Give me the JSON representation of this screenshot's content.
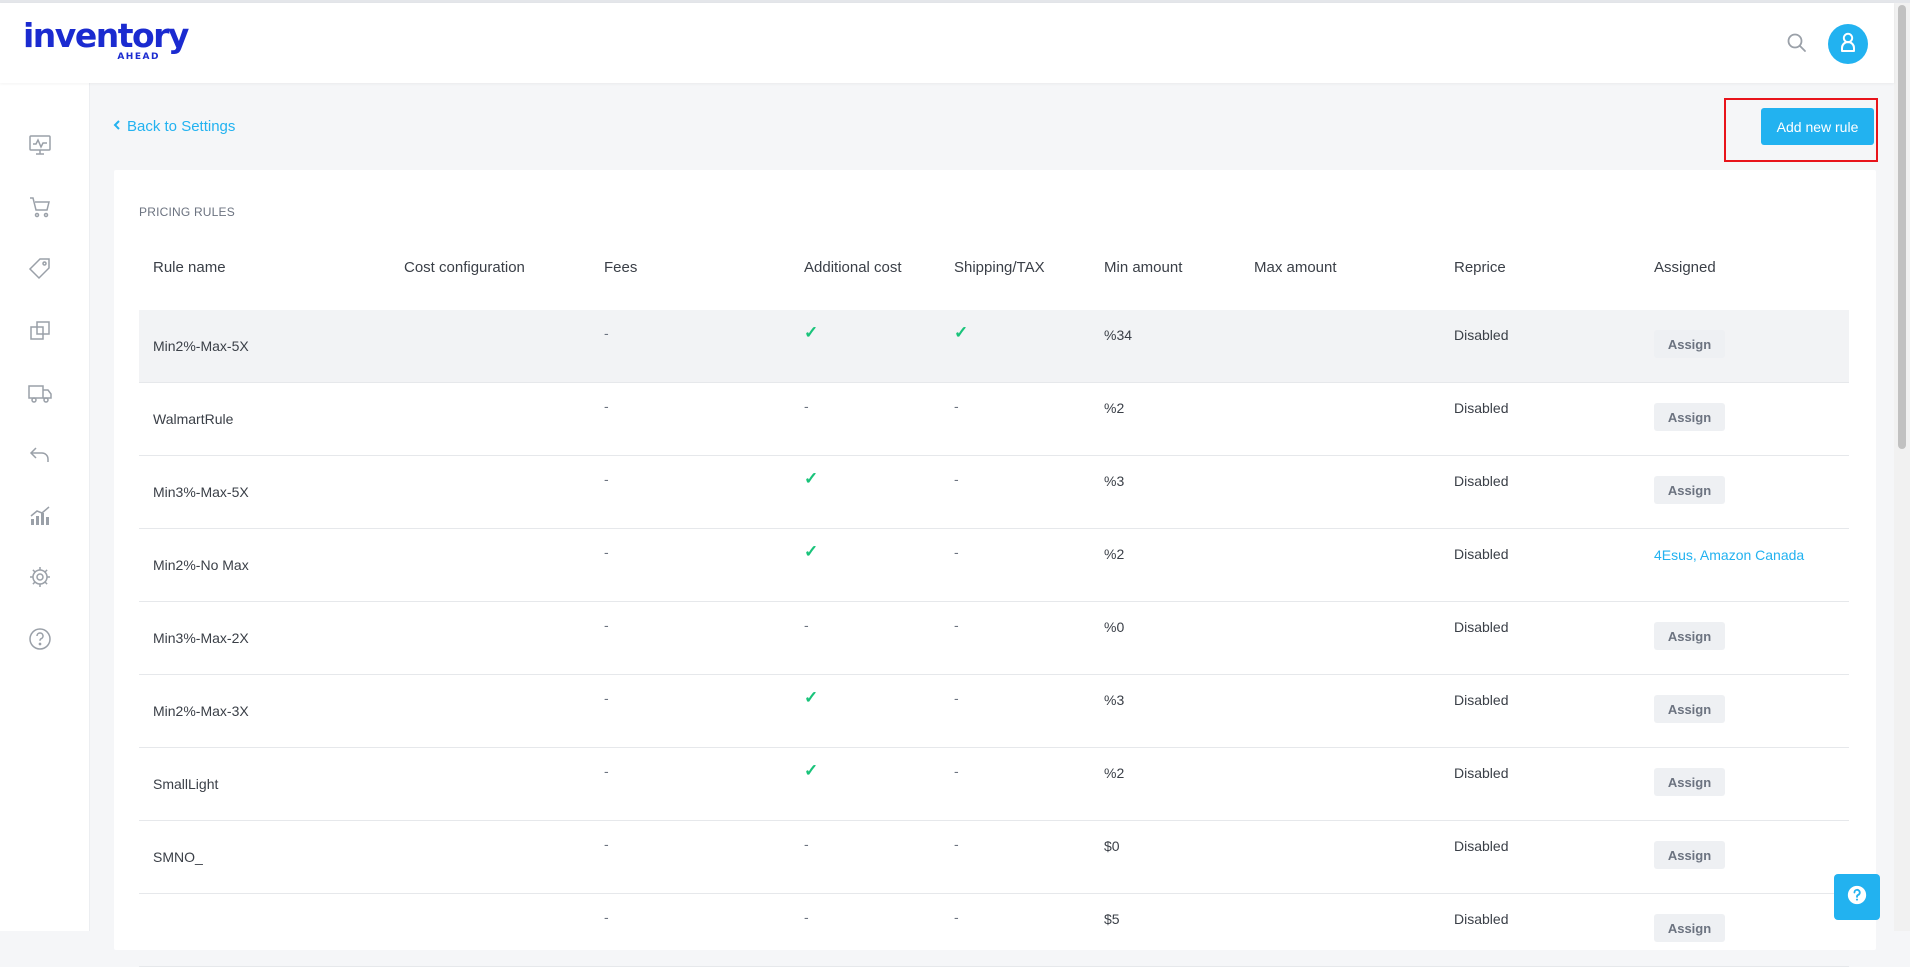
{
  "brand": {
    "logo_main": "inventory",
    "logo_sub": "AHEAD"
  },
  "header": {
    "search_icon": "search-icon",
    "avatar_icon": "user-icon"
  },
  "sidebar": {
    "items": [
      {
        "icon": "dashboard-monitor-icon"
      },
      {
        "icon": "cart-icon"
      },
      {
        "icon": "tag-icon"
      },
      {
        "icon": "copy-icon"
      },
      {
        "icon": "truck-icon"
      },
      {
        "icon": "return-arrow-icon"
      },
      {
        "icon": "analytics-icon"
      },
      {
        "icon": "gear-icon"
      },
      {
        "icon": "help-icon"
      }
    ]
  },
  "nav": {
    "back_label": "Back to Settings"
  },
  "actions": {
    "add_rule_label": "Add new rule"
  },
  "section": {
    "title": "PRICING RULES"
  },
  "table": {
    "columns": [
      "Rule name",
      "Cost configuration",
      "Fees",
      "Additional cost",
      "Shipping/TAX",
      "Min amount",
      "Max amount",
      "Reprice",
      "Assigned"
    ],
    "rows": [
      {
        "name": "Min2%-Max-5X",
        "fees": "-",
        "additional": "✓",
        "shipping": "✓",
        "min": "%34",
        "reprice": "Disabled",
        "assigned": "Assign"
      },
      {
        "name": "WalmartRule",
        "fees": "-",
        "additional": "-",
        "shipping": "-",
        "min": "%2",
        "reprice": "Disabled",
        "assigned": "Assign"
      },
      {
        "name": "Min3%-Max-5X",
        "fees": "-",
        "additional": "✓",
        "shipping": "-",
        "min": "%3",
        "reprice": "Disabled",
        "assigned": "Assign"
      },
      {
        "name": "Min2%-No Max",
        "fees": "-",
        "additional": "✓",
        "shipping": "-",
        "min": "%2",
        "reprice": "Disabled",
        "assigned_link": "4Esus, Amazon Canada"
      },
      {
        "name": "Min3%-Max-2X",
        "fees": "-",
        "additional": "-",
        "shipping": "-",
        "min": "%0",
        "reprice": "Disabled",
        "assigned": "Assign"
      },
      {
        "name": "Min2%-Max-3X",
        "fees": "-",
        "additional": "✓",
        "shipping": "-",
        "min": "%3",
        "reprice": "Disabled",
        "assigned": "Assign"
      },
      {
        "name": "SmallLight",
        "fees": "-",
        "additional": "✓",
        "shipping": "-",
        "min": "%2",
        "reprice": "Disabled",
        "assigned": "Assign"
      },
      {
        "name": "SMNO_",
        "fees": "-",
        "additional": "-",
        "shipping": "-",
        "min": "$0",
        "reprice": "Disabled",
        "assigned": "Assign"
      },
      {
        "name": "",
        "fees": "-",
        "additional": "-",
        "shipping": "-",
        "min": "$5",
        "reprice": "Disabled",
        "assigned": "Assign"
      }
    ]
  },
  "colors": {
    "accent": "#22b2f0",
    "check": "#19c37a",
    "brand": "#1b2bd0",
    "highlight": "#e8141b"
  }
}
